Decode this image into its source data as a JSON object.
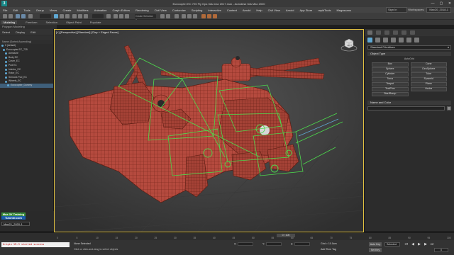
{
  "window": {
    "title": "Eurocopter EC 725 Fly Ops 3ds max 2017.max - Autodesk 3ds Max 2020",
    "controls": [
      "—",
      "▢",
      "✕"
    ]
  },
  "menubar": {
    "items": [
      "File",
      "Edit",
      "Tools",
      "Group",
      "Views",
      "Create",
      "Modifiers",
      "Animation",
      "Graph Editors",
      "Rendering",
      "Civil View",
      "Customize",
      "Scripting",
      "Interactive",
      "Content",
      "Arnold",
      "Help",
      "Civil View",
      "Arnold",
      "App Store",
      "rapidTools",
      "Megascans"
    ],
    "signin": "Sign In",
    "workspaces_label": "Workspaces:",
    "workspace_value": "Max20_2018-1"
  },
  "toolbar": {
    "named_selection": "Create Selection Se"
  },
  "ribbon": {
    "tabs": [
      "Modeling",
      "Freeform",
      "Selection",
      "Object Paint",
      "Populate"
    ],
    "subtitle": "Polygon Modeling"
  },
  "scene_explorer": {
    "tabs": [
      "Select",
      "Display",
      "Edit"
    ],
    "header": "Name (Sorted Ascending)",
    "items": [
      "0 (default)",
      "Eurocopter EC_725",
      "Armature",
      "Body EC",
      "Cover_EC",
      "Pod EC",
      "Interior_EC",
      "Rotor_EC",
      "Sensors Pod_EC",
      "Wheels_EC",
      "Eurocopter_Dummy"
    ],
    "selected_index": 10
  },
  "badge": {
    "line1": "Max 3Y Training",
    "line2": "Tutor3d.com",
    "layer": "Max21_2020-1"
  },
  "viewport": {
    "label": "[+] [Perspective] [Standard] [Clay + Edged Faces]",
    "viewcube_label": "LEFT",
    "border_color": "#e0c040"
  },
  "command_panel": {
    "category": "Standard Primitives",
    "rollout_object_type": "Object Type",
    "autogrid": "AutoGrid",
    "buttons": [
      "Box",
      "Cone",
      "Sphere",
      "GeoSphere",
      "Cylinder",
      "Tube",
      "Torus",
      "Pyramid",
      "Teapot",
      "Plane",
      "TextPlus",
      "Hedra",
      "StartRamp",
      ""
    ],
    "rollout_name_color": "Name and Color"
  },
  "trackbar": {
    "frame_slider": "0 / 100",
    "ticks": [
      "0",
      "5",
      "10",
      "15",
      "20",
      "25",
      "30",
      "35",
      "40",
      "45",
      "50",
      "55",
      "60",
      "65",
      "70",
      "75",
      "80",
      "85",
      "90",
      "95",
      "100"
    ]
  },
  "status": {
    "maxscript": "Origin VR-3 started success",
    "line1": "None Selected",
    "line2": "Click or click-and-drag to select objects",
    "x_label": "X:",
    "y_label": "Y:",
    "z_label": "Z:",
    "grid": "Grid = 10.0cm",
    "add_time_tag": "Add Time Tag",
    "auto_key": "Auto Key",
    "set_key": "Set Key",
    "selected": "Selected",
    "frame": "0"
  }
}
